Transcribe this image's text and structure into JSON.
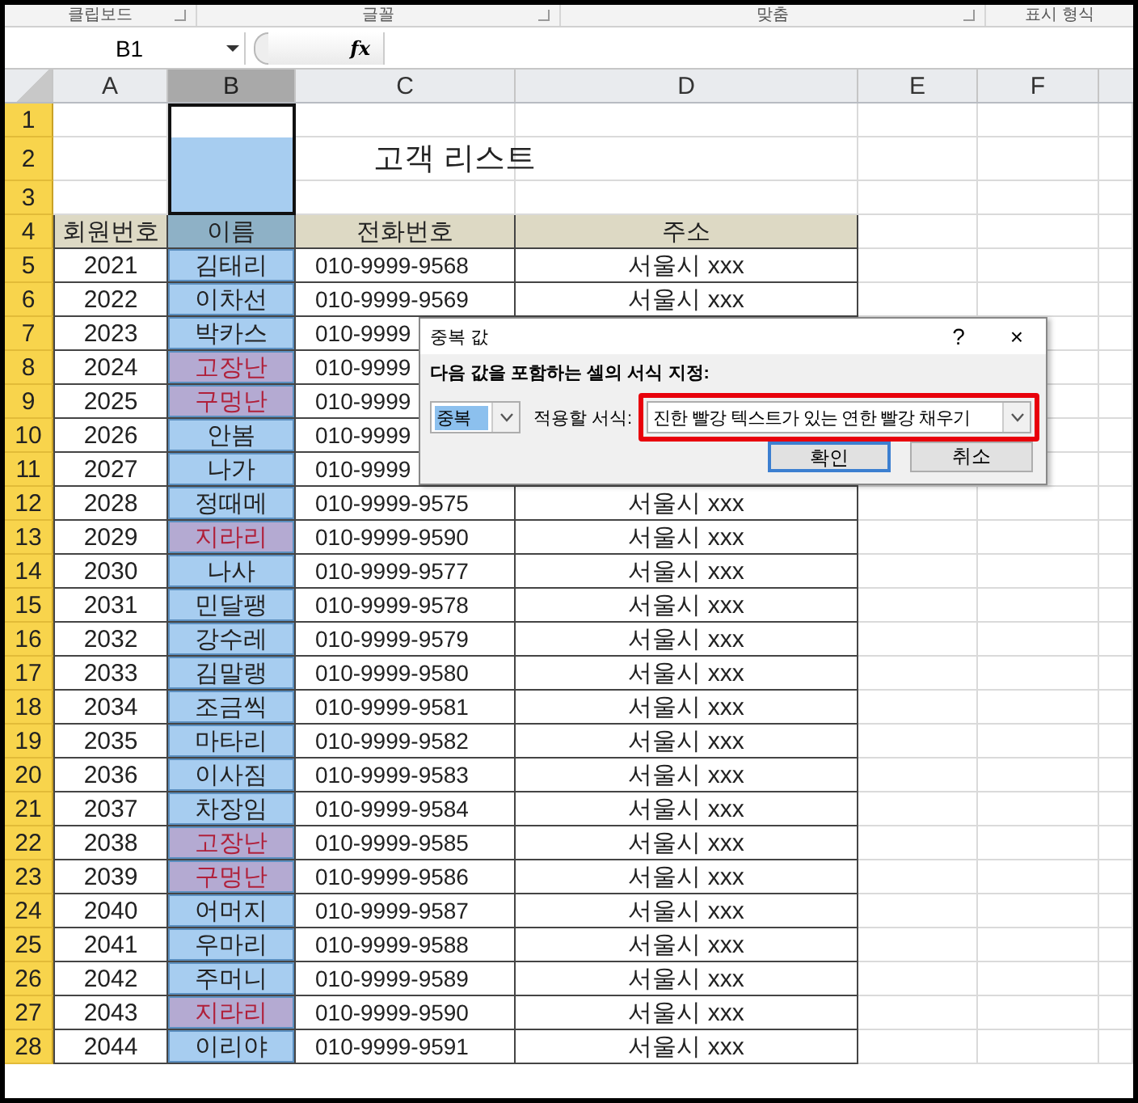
{
  "ribbon_groups": [
    "클립보드",
    "글꼴",
    "맞춤",
    "표시 형식"
  ],
  "name_box": "B1",
  "formula_button": "fx",
  "columns": [
    {
      "label": "A",
      "selected": false
    },
    {
      "label": "B",
      "selected": true
    },
    {
      "label": "C",
      "selected": false
    },
    {
      "label": "D",
      "selected": false
    },
    {
      "label": "E",
      "selected": false
    },
    {
      "label": "F",
      "selected": false
    }
  ],
  "row_numbers": [
    "1",
    "2",
    "3",
    "4",
    "5",
    "6",
    "7",
    "8",
    "9",
    "10",
    "11",
    "12",
    "13",
    "14",
    "15",
    "16",
    "17",
    "18",
    "19",
    "20",
    "21",
    "22",
    "23",
    "24",
    "25",
    "26",
    "27",
    "28"
  ],
  "title": "고객 리스트",
  "headers": [
    "회원번호",
    "이름",
    "전화번호",
    "주소"
  ],
  "records": [
    {
      "id": "2021",
      "name": "김태리",
      "phone": "010-9999-9568",
      "address": "서울시 xxx",
      "duplicate": false
    },
    {
      "id": "2022",
      "name": "이차선",
      "phone": "010-9999-9569",
      "address": "서울시 xxx",
      "duplicate": false
    },
    {
      "id": "2023",
      "name": "박카스",
      "phone": "010-9999",
      "duplicate": false
    },
    {
      "id": "2024",
      "name": "고장난",
      "phone": "010-9999",
      "duplicate": true
    },
    {
      "id": "2025",
      "name": "구멍난",
      "phone": "010-9999",
      "duplicate": true
    },
    {
      "id": "2026",
      "name": "안봄",
      "phone": "010-9999",
      "duplicate": false
    },
    {
      "id": "2027",
      "name": "나가",
      "phone": "010-9999",
      "duplicate": false
    },
    {
      "id": "2028",
      "name": "정때메",
      "phone": "010-9999-9575",
      "address": "서울시 xxx",
      "duplicate": false
    },
    {
      "id": "2029",
      "name": "지라리",
      "phone": "010-9999-9590",
      "address": "서울시 xxx",
      "duplicate": true
    },
    {
      "id": "2030",
      "name": "나사",
      "phone": "010-9999-9577",
      "address": "서울시 xxx",
      "duplicate": false
    },
    {
      "id": "2031",
      "name": "민달팽",
      "phone": "010-9999-9578",
      "address": "서울시 xxx",
      "duplicate": false
    },
    {
      "id": "2032",
      "name": "강수레",
      "phone": "010-9999-9579",
      "address": "서울시 xxx",
      "duplicate": false
    },
    {
      "id": "2033",
      "name": "김말랭",
      "phone": "010-9999-9580",
      "address": "서울시 xxx",
      "duplicate": false
    },
    {
      "id": "2034",
      "name": "조금씩",
      "phone": "010-9999-9581",
      "address": "서울시 xxx",
      "duplicate": false
    },
    {
      "id": "2035",
      "name": "마타리",
      "phone": "010-9999-9582",
      "address": "서울시 xxx",
      "duplicate": false
    },
    {
      "id": "2036",
      "name": "이사짐",
      "phone": "010-9999-9583",
      "address": "서울시 xxx",
      "duplicate": false
    },
    {
      "id": "2037",
      "name": "차장임",
      "phone": "010-9999-9584",
      "address": "서울시 xxx",
      "duplicate": false
    },
    {
      "id": "2038",
      "name": "고장난",
      "phone": "010-9999-9585",
      "address": "서울시 xxx",
      "duplicate": true
    },
    {
      "id": "2039",
      "name": "구멍난",
      "phone": "010-9999-9586",
      "address": "서울시 xxx",
      "duplicate": true
    },
    {
      "id": "2040",
      "name": "어머지",
      "phone": "010-9999-9587",
      "address": "서울시 xxx",
      "duplicate": false
    },
    {
      "id": "2041",
      "name": "우마리",
      "phone": "010-9999-9588",
      "address": "서울시 xxx",
      "duplicate": false
    },
    {
      "id": "2042",
      "name": "주머니",
      "phone": "010-9999-9589",
      "address": "서울시 xxx",
      "duplicate": false
    },
    {
      "id": "2043",
      "name": "지라리",
      "phone": "010-9999-9590",
      "address": "서울시 xxx",
      "duplicate": true
    },
    {
      "id": "2044",
      "name": "이리야",
      "phone": "010-9999-9591",
      "address": "서울시 xxx",
      "duplicate": false
    }
  ],
  "dialog": {
    "title": "중복 값",
    "help": "?",
    "close": "×",
    "prompt": "다음 값을 포함하는 셀의 서식 지정:",
    "rule": {
      "value": "중복",
      "text_selected": true
    },
    "format_label": "적용할 서식:",
    "format": {
      "value": "진한 빨강 텍스트가 있는 연한 빨강 채우기",
      "highlighted": true
    },
    "buttons": [
      {
        "label": "확인",
        "default": true
      },
      {
        "label": "취소",
        "default": false
      }
    ]
  }
}
